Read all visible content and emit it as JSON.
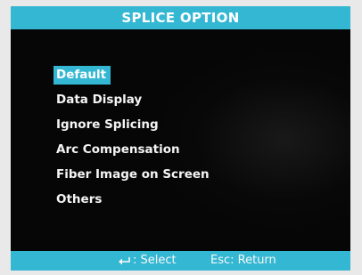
{
  "screen": {
    "title": "SPLICE OPTION"
  },
  "menu": {
    "items": [
      {
        "label": "Default",
        "selected": true
      },
      {
        "label": "Data Display",
        "selected": false
      },
      {
        "label": "Ignore Splicing",
        "selected": false
      },
      {
        "label": "Arc Compensation",
        "selected": false
      },
      {
        "label": "Fiber Image on Screen",
        "selected": false
      },
      {
        "label": "Others",
        "selected": false
      }
    ]
  },
  "footer": {
    "select_icon": "enter-key-icon",
    "select_text": ": Select",
    "return_text": "Esc: Return"
  },
  "colors": {
    "accent": "#34b7d3",
    "background": "#060606",
    "text": "#ffffff"
  }
}
